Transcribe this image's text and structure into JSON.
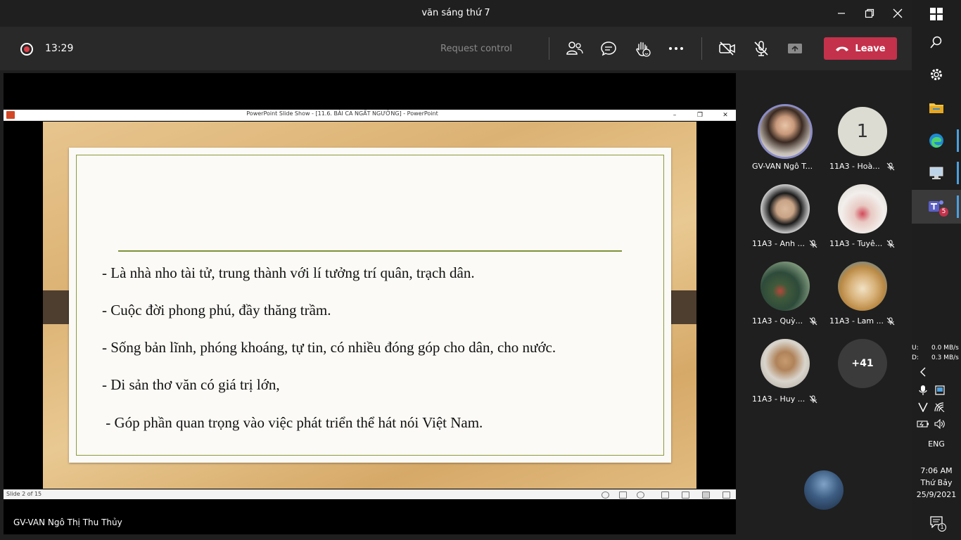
{
  "window": {
    "title": "văn sáng thứ 7"
  },
  "toolbar": {
    "timer": "13:29",
    "request_control": "Request control",
    "leave_label": "Leave"
  },
  "stage": {
    "ppt_window_title": "PowerPoint Slide Show - [11.6. BÀI CA NGẤT NGƯỞNG] - PowerPoint",
    "slide_status": "Slide 2 of 15",
    "slide_lines": [
      "- Là nhà nho tài tử, trung thành với lí tưởng trí quân, trạch dân.",
      "- Cuộc đời phong phú, đầy thăng trầm.",
      "- Sống bản lĩnh, phóng khoáng, tự tin, có nhiều đóng góp cho dân, cho nước.",
      "- Di sản thơ văn có giá trị lớn,",
      " - Góp phần quan trọng vào việc phát triển thể hát nói Việt Nam."
    ],
    "presenter_name": "GV-VAN Ngô Thị Thu Thủy"
  },
  "participants": [
    {
      "name": "GV-VAN Ngô T...",
      "muted": false,
      "avatar": "photo"
    },
    {
      "name": "11A3 - Hoà...",
      "muted": true,
      "avatar": "initial",
      "initial": "1"
    },
    {
      "name": "11A3 - Anh ...",
      "muted": true,
      "avatar": "photo"
    },
    {
      "name": "11A3 - Tuyê...",
      "muted": true,
      "avatar": "photo"
    },
    {
      "name": "11A3 - Quỳ...",
      "muted": true,
      "avatar": "photo"
    },
    {
      "name": "11A3 - Lam ...",
      "muted": true,
      "avatar": "photo"
    },
    {
      "name": "11A3 - Huy ...",
      "muted": true,
      "avatar": "photo"
    }
  ],
  "more_participants": "+41",
  "taskbar": {
    "teams_badge": "5",
    "net_up_label": "U:",
    "net_up": "0.0 MB/s",
    "net_down_label": "D:",
    "net_down": "0.3 MB/s",
    "language": "ENG",
    "time": "7:06 AM",
    "day": "Thứ Bảy",
    "date": "25/9/2021",
    "notification_count": "1"
  },
  "colors": {
    "leave": "#c4314b",
    "accent_ring": "#8b8cc7",
    "slide_rule": "#7d9236"
  }
}
